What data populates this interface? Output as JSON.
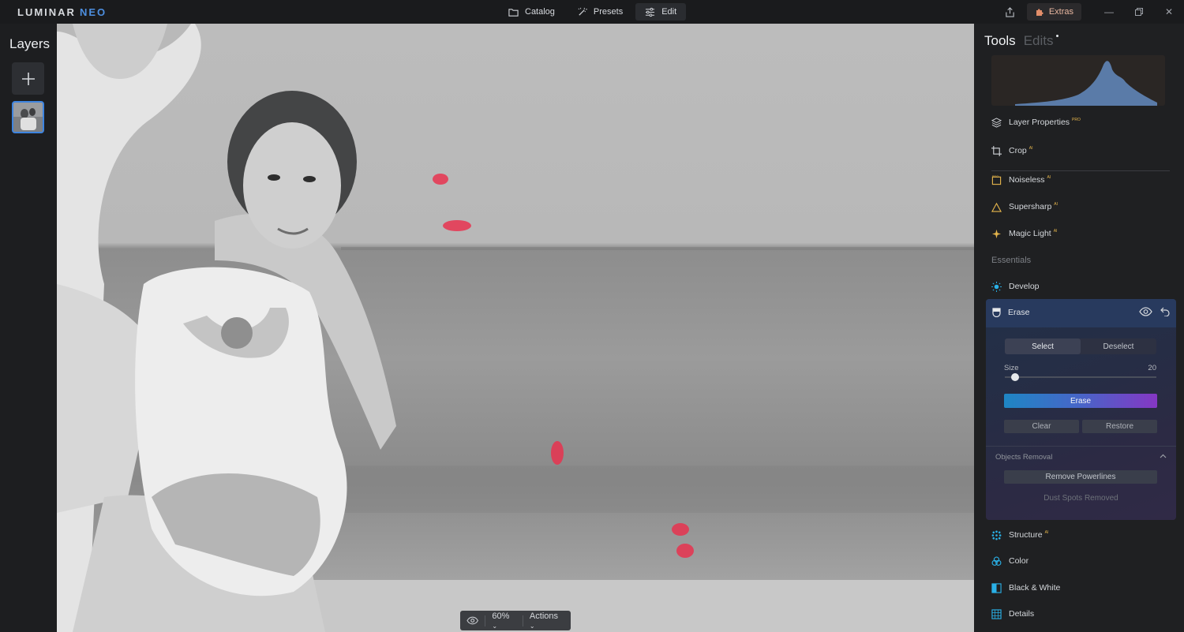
{
  "app": {
    "logo_main": "LUMINAR",
    "logo_sub": "NEO"
  },
  "nav": {
    "tabs": [
      {
        "label": "Catalog",
        "icon": "folder-icon"
      },
      {
        "label": "Presets",
        "icon": "magic-wand-icon"
      },
      {
        "label": "Edit",
        "icon": "sliders-icon",
        "active": true
      }
    ],
    "extras_label": "Extras"
  },
  "layers": {
    "title": "Layers"
  },
  "canvas": {
    "zoom": "60%",
    "actions_label": "Actions"
  },
  "tools": {
    "title_tools": "Tools",
    "title_edits": "Edits",
    "items_top": [
      {
        "label": "Layer Properties",
        "badge": "PRO"
      },
      {
        "label": "Crop",
        "badge": "AI"
      },
      {
        "label": "Noiseless",
        "badge": "AI"
      },
      {
        "label": "Supersharp",
        "badge": "AI"
      },
      {
        "label": "Magic Light",
        "badge": "AI"
      }
    ],
    "section_essentials": "Essentials",
    "develop_label": "Develop",
    "erase": {
      "title": "Erase",
      "select_label": "Select",
      "deselect_label": "Deselect",
      "size_label": "Size",
      "size_value": "20",
      "size_fraction": 0.07,
      "erase_button": "Erase",
      "clear_button": "Clear",
      "restore_button": "Restore",
      "objects_removal_label": "Objects Removal",
      "remove_powerlines_button": "Remove Powerlines",
      "dust_spots_label": "Dust Spots Removed"
    },
    "items_bottom": [
      {
        "label": "Structure",
        "badge": "AI"
      },
      {
        "label": "Color",
        "badge": ""
      },
      {
        "label": "Black & White",
        "badge": ""
      },
      {
        "label": "Details",
        "badge": ""
      }
    ]
  },
  "colors": {
    "accent_blue": "#3d84e0",
    "mask_red": "#e8334f",
    "badge_gold": "#e6b64c",
    "extras_peach": "#e8b7a0"
  }
}
